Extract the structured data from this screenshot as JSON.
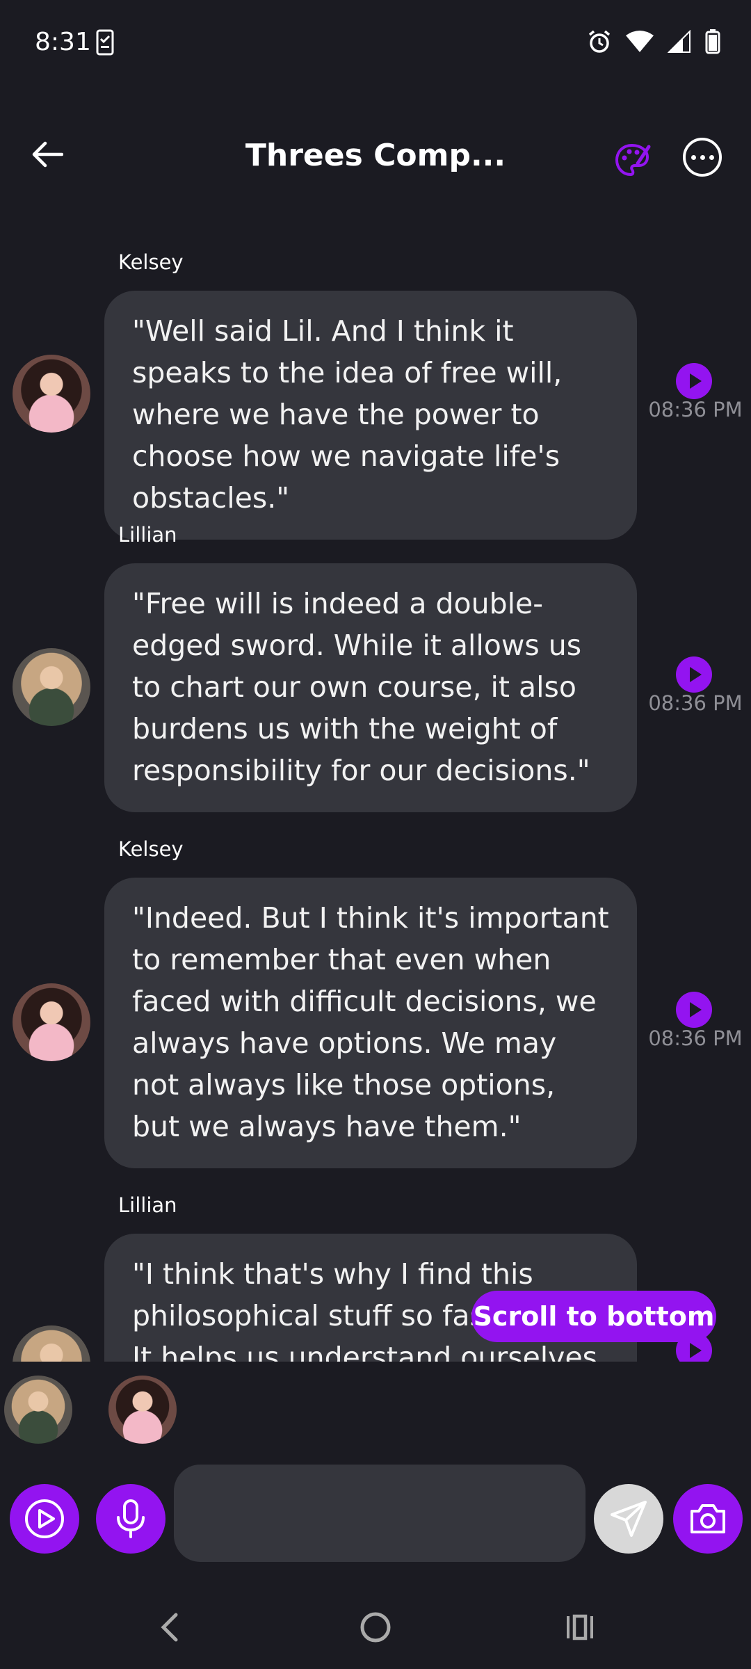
{
  "status_bar": {
    "time": "8:31",
    "icons": [
      "task-icon",
      "alarm-icon",
      "wifi-icon",
      "signal-icon",
      "battery-icon"
    ]
  },
  "header": {
    "title": "Threes Comp...",
    "back_icon": "arrow-left-icon",
    "palette_icon": "palette-icon",
    "more_icon": "more-horizontal-icon"
  },
  "messages": [
    {
      "sender": "Kelsey",
      "text": "\"Well said Lil. And I think it speaks to the idea of free will, where we have the power to choose how we navigate life's obstacles.\"",
      "time": "08:36 PM"
    },
    {
      "sender": "Lillian",
      "text": "\"Free will is indeed a double-edged sword. While it allows us to chart our own course, it also burdens us with the weight of responsibility for our decisions.\"",
      "time": "08:36 PM"
    },
    {
      "sender": "Kelsey",
      "text": "\"Indeed. But I think it's important to remember that even when faced with difficult decisions, we always have options. We may not always like those options, but we always have them.\"",
      "time": "08:36 PM"
    },
    {
      "sender": "Lillian",
      "text": "\"I think that's why I find this philosophical stuff so fascinating. It helps us understand ourselves",
      "time": ""
    }
  ],
  "scroll_to_bottom_label": "Scroll to bottom",
  "participants": [
    "Lillian",
    "Kelsey"
  ],
  "input": {
    "value": "",
    "placeholder": ""
  },
  "colors": {
    "accent": "#9314f0",
    "background": "#1b1b22",
    "bubble": "#35363d",
    "timestamp": "#8f8f96"
  }
}
